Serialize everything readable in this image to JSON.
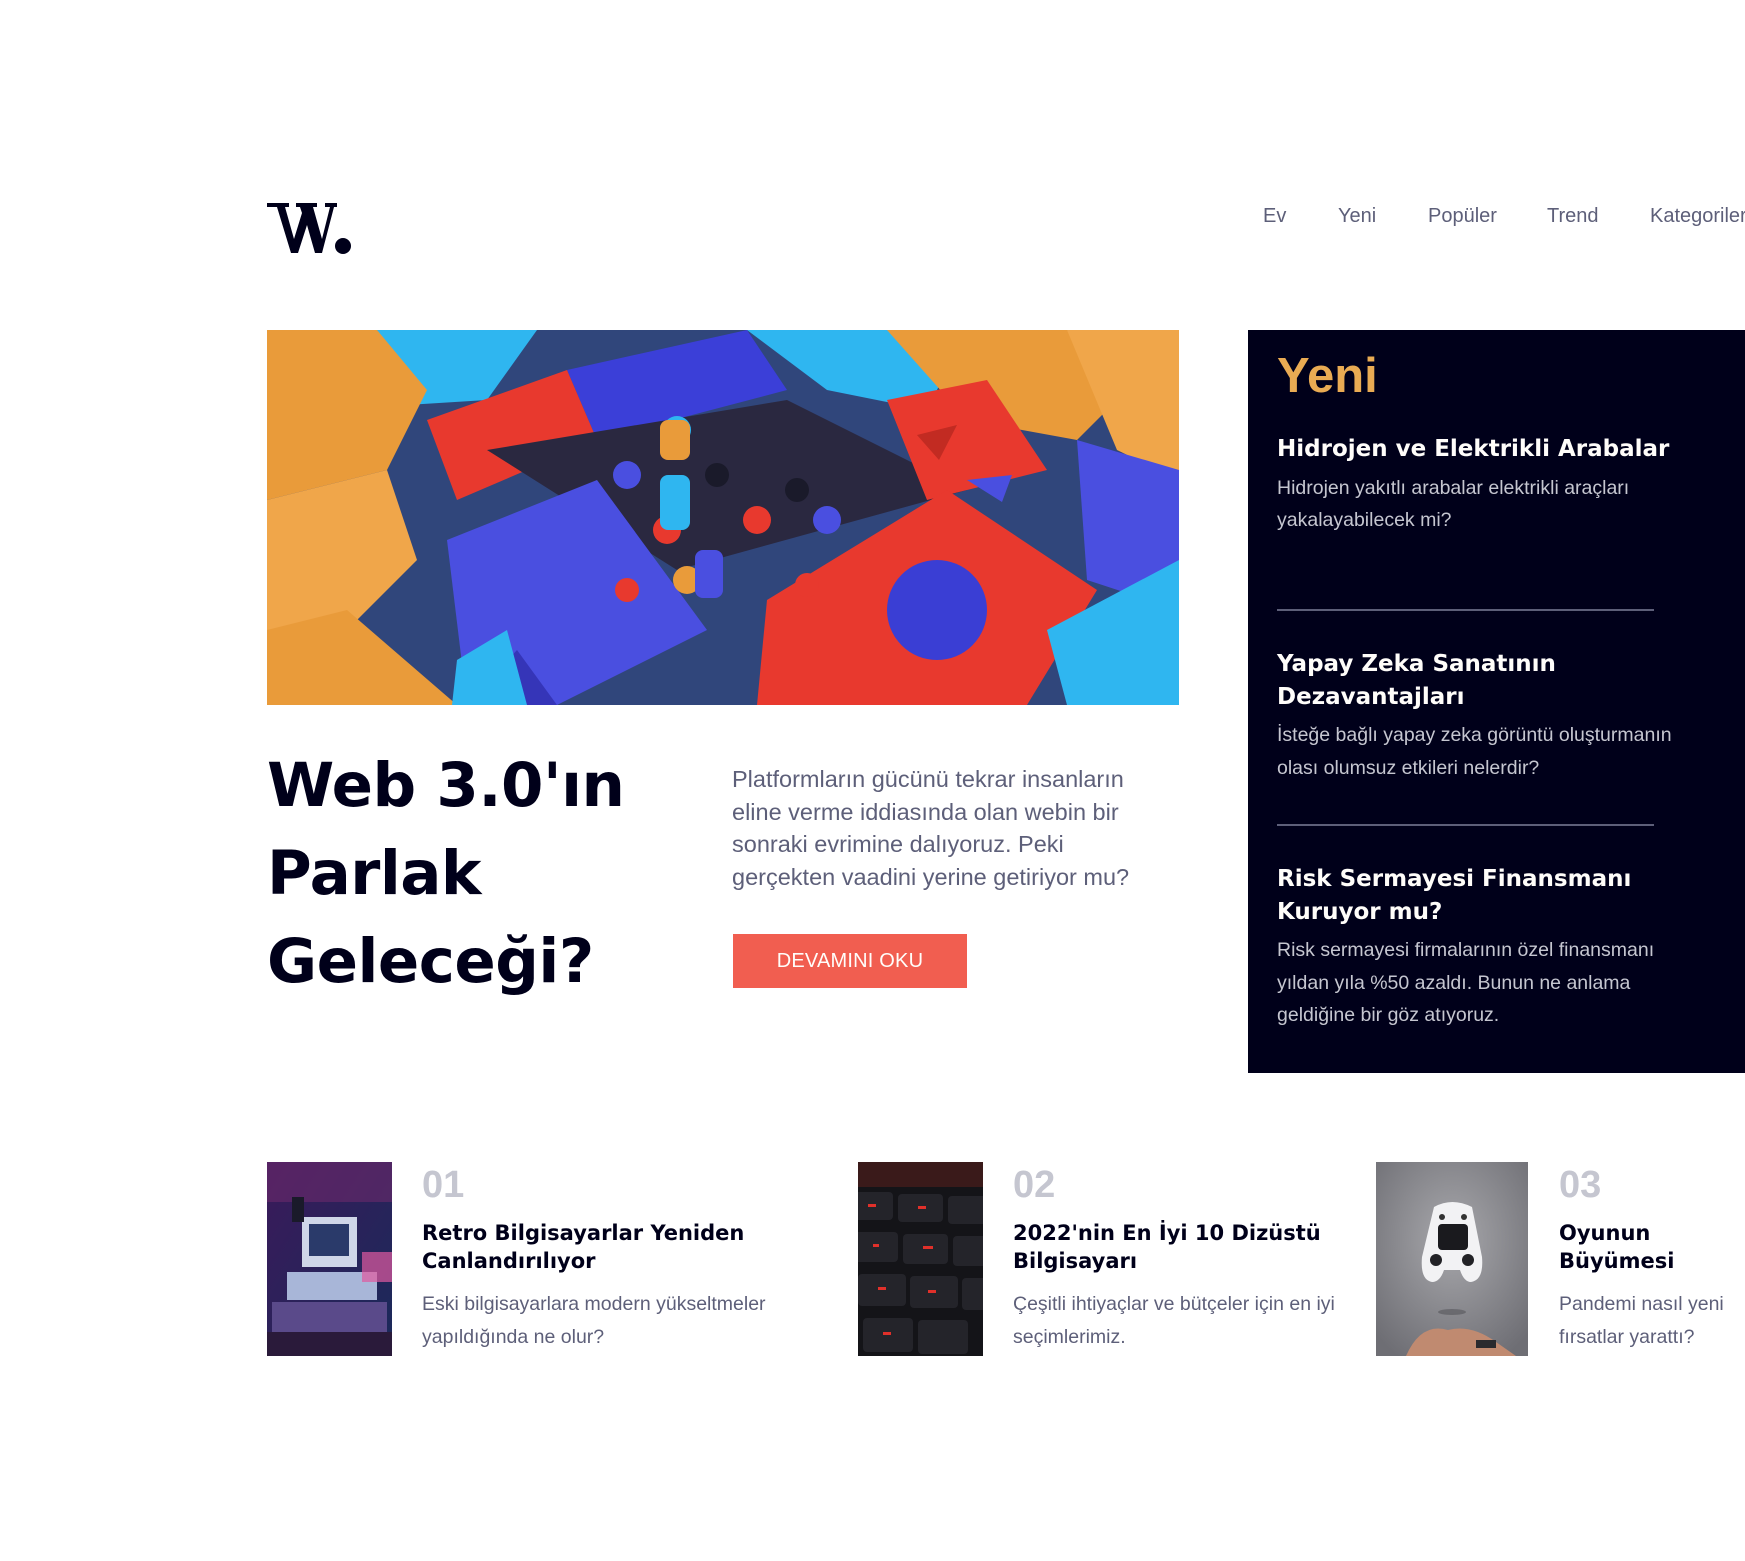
{
  "brand": {
    "logo_text": "W."
  },
  "nav": {
    "items": [
      {
        "label": "Ev"
      },
      {
        "label": "Yeni"
      },
      {
        "label": "Popüler"
      },
      {
        "label": "Trend"
      },
      {
        "label": "Kategoriler"
      }
    ]
  },
  "hero": {
    "title_line1": "Web 3.0'ın",
    "title_line2": "Parlak",
    "title_line3": "Geleceği?",
    "description": "Platformların gücünü tekrar insanların eline verme iddiasında olan webin bir sonraki evrimine dalıyoruz. Peki gerçekten vaadini yerine getiriyor mu?",
    "button_label": "DEVAMINI OKU"
  },
  "new_panel": {
    "heading": "Yeni",
    "items": [
      {
        "title": "Hidrojen ve Elektrikli Arabalar",
        "text": "Hidrojen yakıtlı arabalar elektrikli araçları yakalayabilecek mi?"
      },
      {
        "title": "Yapay Zeka Sanatının Dezavantajları",
        "text": "İsteğe bağlı yapay zeka görüntü oluşturmanın olası olumsuz etkileri nelerdir?"
      },
      {
        "title": "Risk Sermayesi Finansmanı Kuruyor mu?",
        "text": "Risk sermayesi firmalarının özel finansmanı yıldan yıla %50 azaldı. Bunun ne anlama geldiğine bir göz atıyoruz."
      }
    ]
  },
  "articles": [
    {
      "number": "01",
      "title": "Retro Bilgisayarlar Yeniden Canlandırılıyor",
      "text": "Eski bilgisayarlara modern yükseltmeler yapıldığında ne olur?"
    },
    {
      "number": "02",
      "title": "2022'nin En İyi 10 Dizüstü Bilgisayarı",
      "text": "Çeşitli ihtiyaçlar ve bütçeler için en iyi seçimlerimiz."
    },
    {
      "number": "03",
      "title": "Oyunun Büyümesi",
      "text": "Pandemi nasıl yeni fırsatlar yarattı?"
    }
  ],
  "colors": {
    "dark_navy": "#00001a",
    "soft_red": "#f15e50",
    "soft_orange": "#e9ab53",
    "grayish_blue": "#c5c6d0",
    "dark_grayish_blue": "#5d5f79",
    "off_white": "#fffdfa"
  }
}
